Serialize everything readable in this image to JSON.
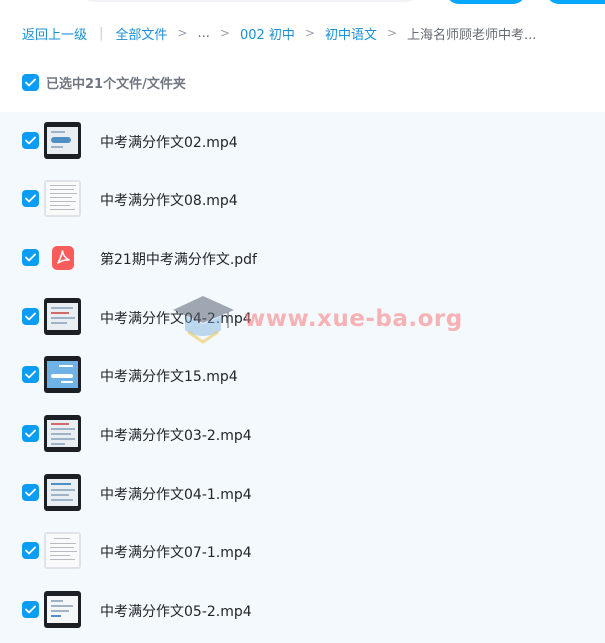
{
  "breadcrumb": {
    "back": "返回上一级",
    "items": [
      "全部文件",
      "...",
      "002 初中",
      "初中语文"
    ],
    "current": "上海名师顾老师中考..."
  },
  "selection": {
    "summary": "已选中21个文件/文件夹"
  },
  "files": [
    {
      "name": "中考满分作文02.mp4",
      "type": "video",
      "thumb": "slide"
    },
    {
      "name": "中考满分作文08.mp4",
      "type": "video",
      "thumb": "paper"
    },
    {
      "name": "第21期中考满分作文.pdf",
      "type": "pdf"
    },
    {
      "name": "中考满分作文04-2.mp4",
      "type": "video",
      "thumb": "slide"
    },
    {
      "name": "中考满分作文15.mp4",
      "type": "video",
      "thumb": "blue"
    },
    {
      "name": "中考满分作文03-2.mp4",
      "type": "video",
      "thumb": "slide"
    },
    {
      "name": "中考满分作文04-1.mp4",
      "type": "video",
      "thumb": "slide"
    },
    {
      "name": "中考满分作文07-1.mp4",
      "type": "video",
      "thumb": "paper"
    },
    {
      "name": "中考满分作文05-2.mp4",
      "type": "video",
      "thumb": "slide"
    }
  ],
  "watermark": {
    "text": "www.xue-ba.org"
  },
  "colors": {
    "accent": "#0b9cf5",
    "link": "#1a8fd6",
    "list_bg": "#f4f9fe",
    "pdf": "#fa5b5b"
  },
  "icons": {
    "checkbox": "check-icon",
    "pdf": "pdf-file-icon",
    "video": "video-thumbnail",
    "separator": "chevron-right-icon",
    "watermark": "graduation-cap-icon"
  }
}
